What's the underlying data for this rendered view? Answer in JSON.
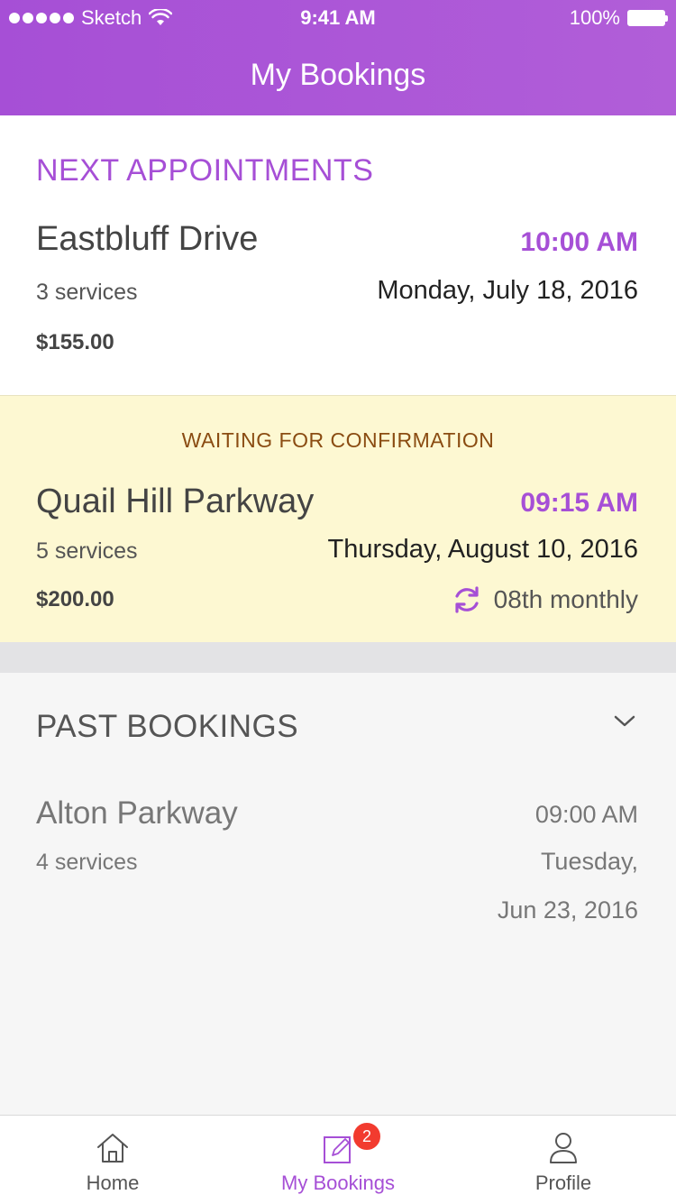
{
  "status_bar": {
    "carrier": "Sketch",
    "time": "9:41 AM",
    "battery": "100%"
  },
  "header": {
    "title": "My Bookings"
  },
  "next_appointments": {
    "heading": "NEXT APPOINTMENTS",
    "items": [
      {
        "place": "Eastbluff Drive",
        "time": "10:00 AM",
        "services": "3 services",
        "date": "Monday, July 18, 2016",
        "price": "$155.00"
      }
    ]
  },
  "waiting": {
    "label": "WAITING FOR CONFIRMATION",
    "place": "Quail Hill Parkway",
    "time": "09:15 AM",
    "services": "5 services",
    "date": "Thursday, August 10, 2016",
    "price": "$200.00",
    "recurrence": "08th monthly"
  },
  "past_bookings": {
    "heading": "PAST BOOKINGS",
    "items": [
      {
        "place": "Alton Parkway",
        "time": "09:00 AM",
        "services": "4 services",
        "date_line1": "Tuesday,",
        "date_line2": "Jun 23, 2016"
      }
    ]
  },
  "tabbar": {
    "tabs": [
      {
        "label": "Home",
        "icon": "home-icon",
        "active": false
      },
      {
        "label": "My Bookings",
        "icon": "edit-icon",
        "active": true,
        "badge": "2"
      },
      {
        "label": "Profile",
        "icon": "person-icon",
        "active": false
      }
    ]
  },
  "colors": {
    "accent": "#a64fd6",
    "waiting_bg": "#fdf8d2",
    "waiting_text": "#8a4c12",
    "badge": "#f23b2f"
  }
}
